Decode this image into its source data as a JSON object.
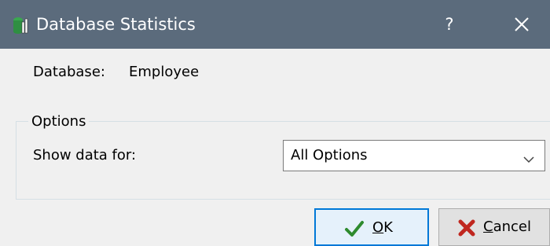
{
  "window": {
    "title": "Database Statistics",
    "help_label": "?",
    "icon": "database-stats-icon",
    "titlebar_color": "#5b6b7c"
  },
  "database": {
    "label": "Database:",
    "value": "Employee"
  },
  "options": {
    "group_label": "Options",
    "show_label": "Show data for:",
    "selected": "All Options"
  },
  "buttons": {
    "ok": {
      "mnemonic": "O",
      "rest": "K",
      "icon": "checkmark-icon"
    },
    "cancel": {
      "mnemonic": "C",
      "rest": "ancel",
      "icon": "cross-icon"
    }
  }
}
